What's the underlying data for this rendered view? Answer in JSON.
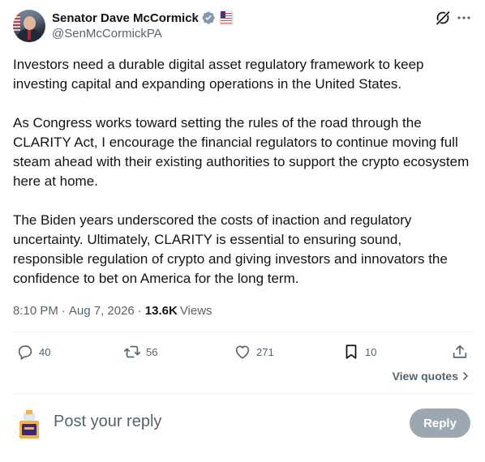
{
  "author": {
    "display_name": "Senator Dave McCormick",
    "handle": "@SenMcCormickPA"
  },
  "tweet": {
    "paragraphs": [
      "Investors need a durable digital asset regulatory framework to keep investing capital and expanding operations in the United States.",
      "As Congress works toward setting the rules of the road through the CLARITY Act, I encourage the financial regulators to continue moving full steam ahead with their existing authorities to support the crypto ecosystem here at home.",
      "The Biden years underscored the costs of inaction and regulatory uncertainty. Ultimately, CLARITY is essential to ensuring sound, responsible regulation of crypto and giving investors and innovators the confidence to bet on America for the long term."
    ],
    "time": "8:10 PM",
    "separator": "·",
    "date": "Aug 7, 2026",
    "views_count": "13.6K",
    "views_label": "Views"
  },
  "actions": {
    "replies": "40",
    "reposts": "56",
    "likes": "271",
    "bookmarks": "10"
  },
  "view_quotes_label": "View quotes",
  "reply_box": {
    "placeholder": "Post your reply",
    "button_label": "Reply"
  },
  "icons": {
    "verified": "verified-badge-icon",
    "affiliation": "senate-affiliation-icon",
    "grok": "grok-icon",
    "more": "more-icon",
    "reply": "reply-icon",
    "repost": "repost-icon",
    "like": "heart-icon",
    "bookmark": "bookmark-icon",
    "share": "share-icon",
    "chevron": "chevron-right-icon"
  },
  "colors": {
    "text": "#0f1419",
    "secondary": "#536471",
    "verified": "#829aab",
    "divider": "#eff3f4",
    "reply_button": "#8b98a5"
  }
}
